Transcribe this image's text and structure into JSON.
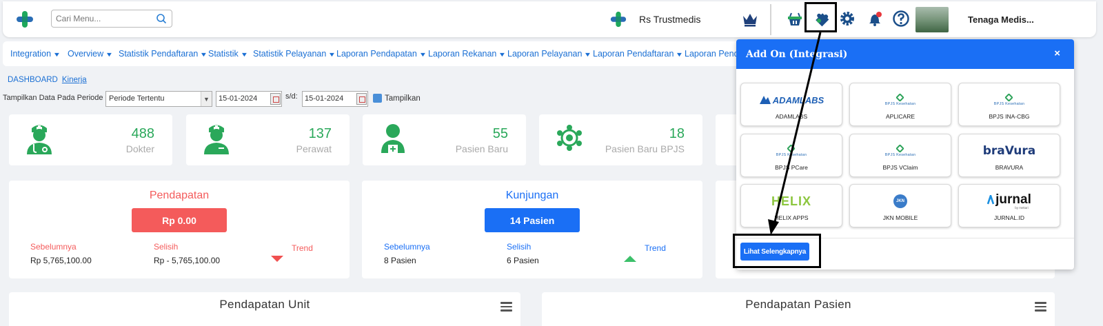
{
  "topbar": {
    "search_placeholder": "Cari Menu...",
    "hospital_name": "Rs Trustmedis",
    "user_name": "Tenaga Medis..."
  },
  "nav": {
    "items": [
      "Integration",
      "Overview",
      "Statistik Pendaftaran",
      "Statistik",
      "Statistik Pelayanan",
      "Laporan Pendapatan",
      "Laporan Rekanan",
      "Laporan Pelayanan",
      "Laporan Pendaftaran",
      "Laporan Penda"
    ]
  },
  "breadcrumb": {
    "root": "DASHBOARD",
    "current": "Kinerja"
  },
  "filter": {
    "label": "Tampilkan Data Pada Periode :",
    "period": "Periode Tertentu",
    "date_from": "15-01-2024",
    "sd_label": "s/d:",
    "date_to": "15-01-2024",
    "button": "Tampilkan"
  },
  "stats": [
    {
      "value": "488",
      "label": "Dokter",
      "icon": "doctor-icon"
    },
    {
      "value": "137",
      "label": "Perawat",
      "icon": "nurse-icon"
    },
    {
      "value": "55",
      "label": "Pasien Baru",
      "icon": "patient-icon"
    },
    {
      "value": "18",
      "label": "Pasien Baru BPJS",
      "icon": "bpjs-patient-icon"
    }
  ],
  "pendapatan": {
    "title": "Pendapatan",
    "total": "Rp 0.00",
    "prev_label": "Sebelumnya",
    "prev_value": "Rp 5,765,100.00",
    "diff_label": "Selisih",
    "diff_value": "Rp - 5,765,100.00",
    "trend_label": "Trend"
  },
  "kunjungan": {
    "title": "Kunjungan",
    "total": "14 Pasien",
    "prev_label": "Sebelumnya",
    "prev_value": "8 Pasien",
    "diff_label": "Selisih",
    "diff_value": "6 Pasien",
    "trend_label": "Trend"
  },
  "charts": {
    "unit_title": "Pendapatan Unit",
    "pasien_title": "Pendapatan Pasien"
  },
  "popup": {
    "title": "Add On (Integrasi)",
    "close": "×",
    "tiles": [
      {
        "name": "ADAMLABS",
        "logo": "ADAMLABS"
      },
      {
        "name": "APLICARE",
        "logo": "BPJS Kesehatan"
      },
      {
        "name": "BPJS INA-CBG",
        "logo": "BPJS Kesehatan"
      },
      {
        "name": "BPJS PCare",
        "logo": "BPJS Kesehatan"
      },
      {
        "name": "BPJS VClaim",
        "logo": "BPJS Kesehatan"
      },
      {
        "name": "BRAVURA",
        "logo": "braVura"
      },
      {
        "name": "HELIX APPS",
        "logo": "HELIX"
      },
      {
        "name": "JKN MOBILE",
        "logo": "JKN"
      },
      {
        "name": "JURNAL.ID",
        "logo": "jurnal",
        "logo_sub": "by mekari"
      }
    ],
    "more_button": "Lihat Selengkapnya"
  },
  "colors": {
    "brand_blue": "#1a6ff5",
    "green": "#2aa85a",
    "red": "#f45b5b",
    "annotation": "#000000"
  }
}
